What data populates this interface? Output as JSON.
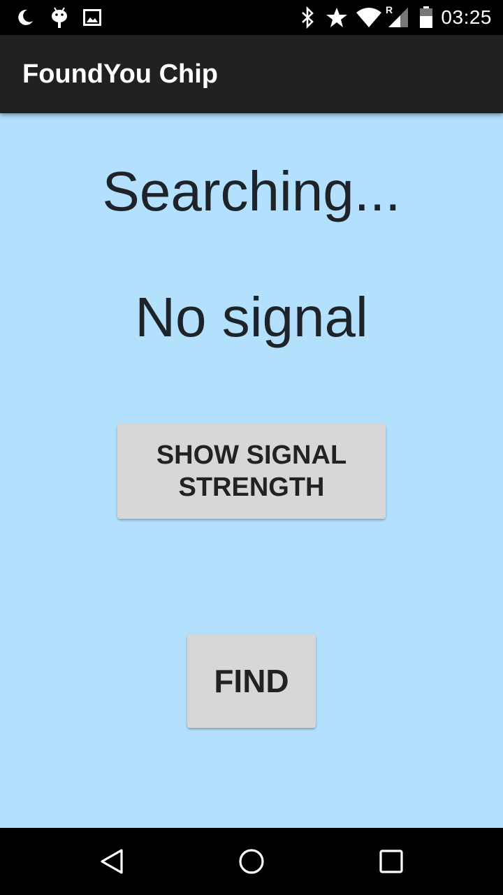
{
  "status_bar": {
    "time": "03:25",
    "icons": [
      "moon-icon",
      "android-debug-icon",
      "image-icon",
      "bluetooth-icon",
      "star-icon",
      "wifi-icon",
      "signal-icon",
      "battery-icon"
    ],
    "roaming_label": "R"
  },
  "app_bar": {
    "title": "FoundYou Chip"
  },
  "main": {
    "searching_text": "Searching...",
    "signal_text": "No signal",
    "show_signal_button": "SHOW SIGNAL STRENGTH",
    "find_button": "FIND"
  },
  "nav_bar": {
    "icons": [
      "back-icon",
      "home-icon",
      "recents-icon"
    ]
  },
  "colors": {
    "background": "#b3e0fd",
    "app_bar": "#212121",
    "button": "#d7d7d7",
    "text": "#1d2329"
  }
}
